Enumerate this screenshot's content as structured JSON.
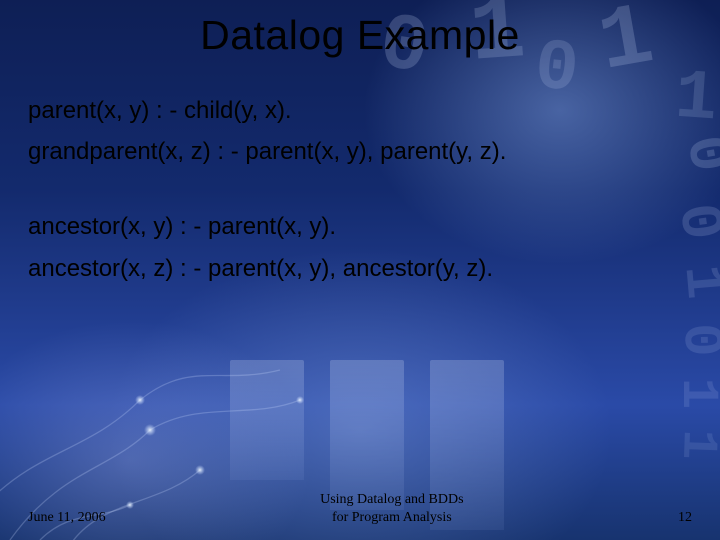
{
  "title": "Datalog Example",
  "rules": [
    "parent(x, y) : - child(y, x).",
    "grandparent(x, z) : - parent(x, y), parent(y, z).",
    "",
    "ancestor(x, y) : - parent(x, y).",
    "ancestor(x, z) : - parent(x, y), ancestor(y, z)."
  ],
  "footer": {
    "date": "June 11, 2006",
    "center_line1": "Using Datalog and BDDs",
    "center_line2": "for Program Analysis",
    "page": "12"
  }
}
